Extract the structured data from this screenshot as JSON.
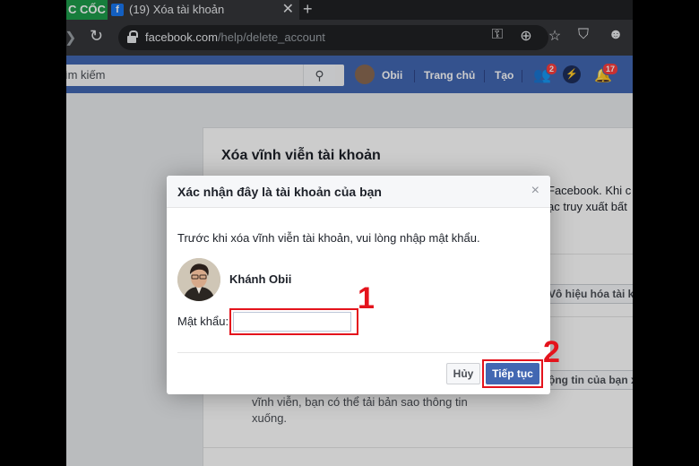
{
  "browser": {
    "brand_tab": "C CỐC",
    "tab_title": "(19) Xóa tài khoản",
    "tab_close": "✕",
    "new_tab": "+",
    "url_domain": "facebook.com",
    "url_path": "/help/delete_account",
    "toolbar_icons": [
      "key-icon",
      "zoom-icon",
      "star-icon",
      "shield-icon",
      "profile-icon"
    ]
  },
  "fb_header": {
    "search_placeholder": "ìm kiếm",
    "user_name": "Obii",
    "home_label": "Trang chủ",
    "create_label": "Tạo",
    "friend_requests_count": "2",
    "notifications_count": "17"
  },
  "background_page": {
    "title": "Xóa vĩnh viễn tài khoản",
    "snippet_line1": "Facebook. Khi c",
    "snippet_line2": "ạc truy xuất bất",
    "deactivate_button": "Vô hiệu hóa tài k",
    "download_button": "ộng tin của bạn x",
    "text_line1": "vĩnh viễn, bạn có thể tải bản sao thông tin",
    "text_line2": "xuống."
  },
  "modal": {
    "title": "Xác nhận đây là tài khoản của bạn",
    "close_icon": "×",
    "intro": "Trước khi xóa vĩnh viễn tài khoản, vui lòng nhập mật khẩu.",
    "account_name": "Khánh Obii",
    "password_label": "Mật khẩu:",
    "password_value": "",
    "cancel_label": "Hủy",
    "continue_label": "Tiếp tục"
  },
  "annotations": {
    "step1": "1",
    "step2": "2",
    "color": "#e4131c"
  }
}
